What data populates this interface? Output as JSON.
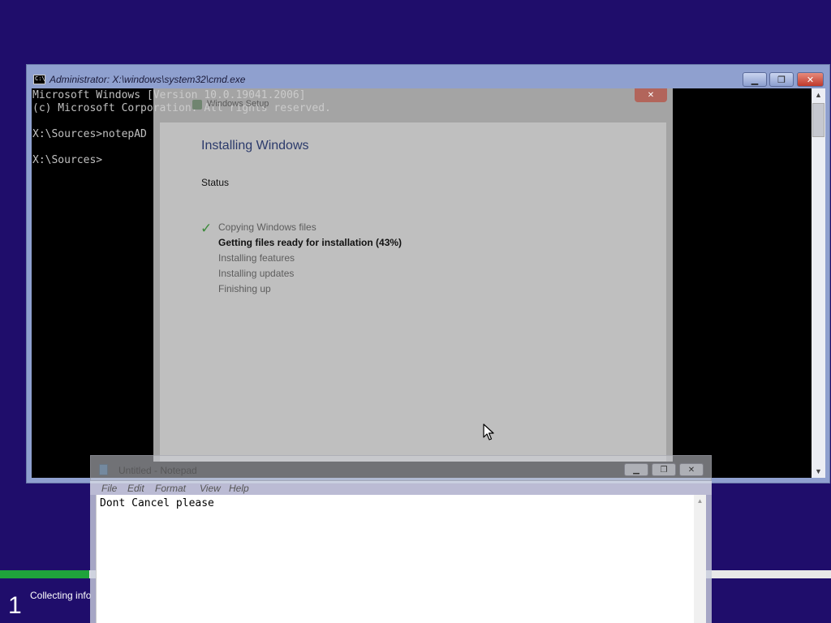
{
  "setup_progress": {
    "fill_percent": 10.7,
    "step_number": "1",
    "step_label": "Collecting info"
  },
  "cmd": {
    "title": "Administrator: X:\\windows\\system32\\cmd.exe",
    "lines": [
      "Microsoft Windows [Version 10.0.19041.2006]",
      "(c) Microsoft Corporation. All rights reserved.",
      "",
      "X:\\Sources>notepAD",
      "",
      "X:\\Sources>"
    ],
    "icon": "cmd-icon",
    "minimize_icon": "minimize-icon",
    "maximize_icon": "maximize-icon",
    "close_icon": "close-icon"
  },
  "setup": {
    "title": "Windows Setup",
    "heading": "Installing Windows",
    "status_label": "Status",
    "steps": [
      {
        "label": "Copying Windows files",
        "state": "done"
      },
      {
        "label": "Getting files ready for installation (43%)",
        "state": "active"
      },
      {
        "label": "Installing features",
        "state": "pending"
      },
      {
        "label": "Installing updates",
        "state": "pending"
      },
      {
        "label": "Finishing up",
        "state": "pending"
      }
    ]
  },
  "notepad": {
    "title": "Untitled - Notepad",
    "menu": [
      "File",
      "Edit",
      "Format",
      "View",
      "Help"
    ],
    "content": "Dont Cancel please"
  },
  "colors": {
    "desktop": "#1f0d6b",
    "progress": "#1fa33b",
    "console_bg": "#000000",
    "console_fg": "#c0c0c0"
  }
}
